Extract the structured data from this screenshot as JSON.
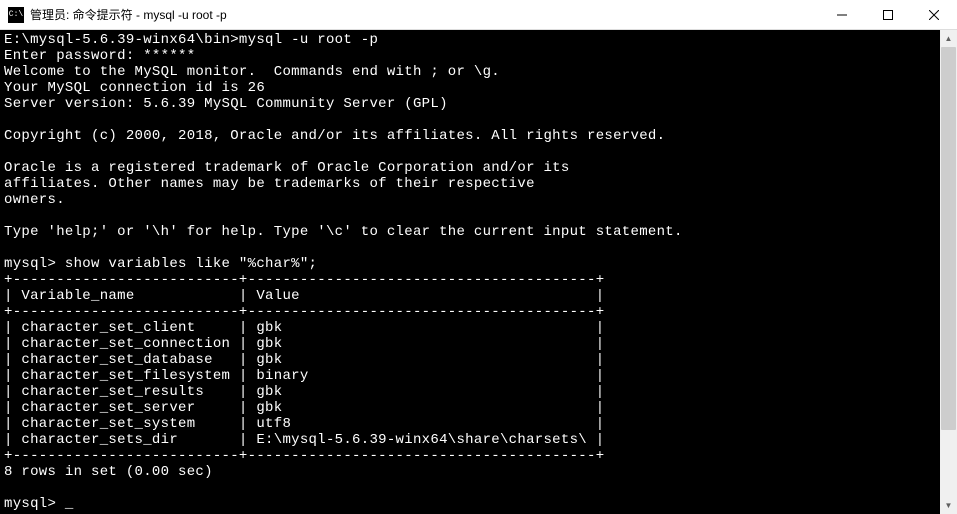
{
  "titlebar": {
    "icon_text": "C:\\",
    "title": "管理员: 命令提示符 - mysql  -u root -p"
  },
  "terminal": {
    "prompt_path": "E:\\mysql-5.6.39-winx64\\bin>",
    "command": "mysql -u root -p",
    "password_line": "Enter password: ******",
    "welcome": "Welcome to the MySQL monitor.  Commands end with ; or \\g.",
    "connection_id": "Your MySQL connection id is 26",
    "server_version": "Server version: 5.6.39 MySQL Community Server (GPL)",
    "copyright": "Copyright (c) 2000, 2018, Oracle and/or its affiliates. All rights reserved.",
    "trademark1": "Oracle is a registered trademark of Oracle Corporation and/or its",
    "trademark2": "affiliates. Other names may be trademarks of their respective",
    "trademark3": "owners.",
    "help_line": "Type 'help;' or '\\h' for help. Type '\\c' to clear the current input statement.",
    "mysql_prompt": "mysql>",
    "query": "show variables like \"%char%\";",
    "table_border": "+--------------------------+----------------------------------------+",
    "table_header": "| Variable_name            | Value                                  |",
    "table_rows": [
      "| character_set_client     | gbk                                    |",
      "| character_set_connection | gbk                                    |",
      "| character_set_database   | gbk                                    |",
      "| character_set_filesystem | binary                                 |",
      "| character_set_results    | gbk                                    |",
      "| character_set_server     | gbk                                    |",
      "| character_set_system     | utf8                                   |",
      "| character_sets_dir       | E:\\mysql-5.6.39-winx64\\share\\charsets\\ |"
    ],
    "result_summary": "8 rows in set (0.00 sec)",
    "cursor": "_"
  },
  "table_data": {
    "columns": [
      "Variable_name",
      "Value"
    ],
    "rows": [
      {
        "Variable_name": "character_set_client",
        "Value": "gbk"
      },
      {
        "Variable_name": "character_set_connection",
        "Value": "gbk"
      },
      {
        "Variable_name": "character_set_database",
        "Value": "gbk"
      },
      {
        "Variable_name": "character_set_filesystem",
        "Value": "binary"
      },
      {
        "Variable_name": "character_set_results",
        "Value": "gbk"
      },
      {
        "Variable_name": "character_set_server",
        "Value": "gbk"
      },
      {
        "Variable_name": "character_set_system",
        "Value": "utf8"
      },
      {
        "Variable_name": "character_sets_dir",
        "Value": "E:\\mysql-5.6.39-winx64\\share\\charsets\\"
      }
    ]
  }
}
